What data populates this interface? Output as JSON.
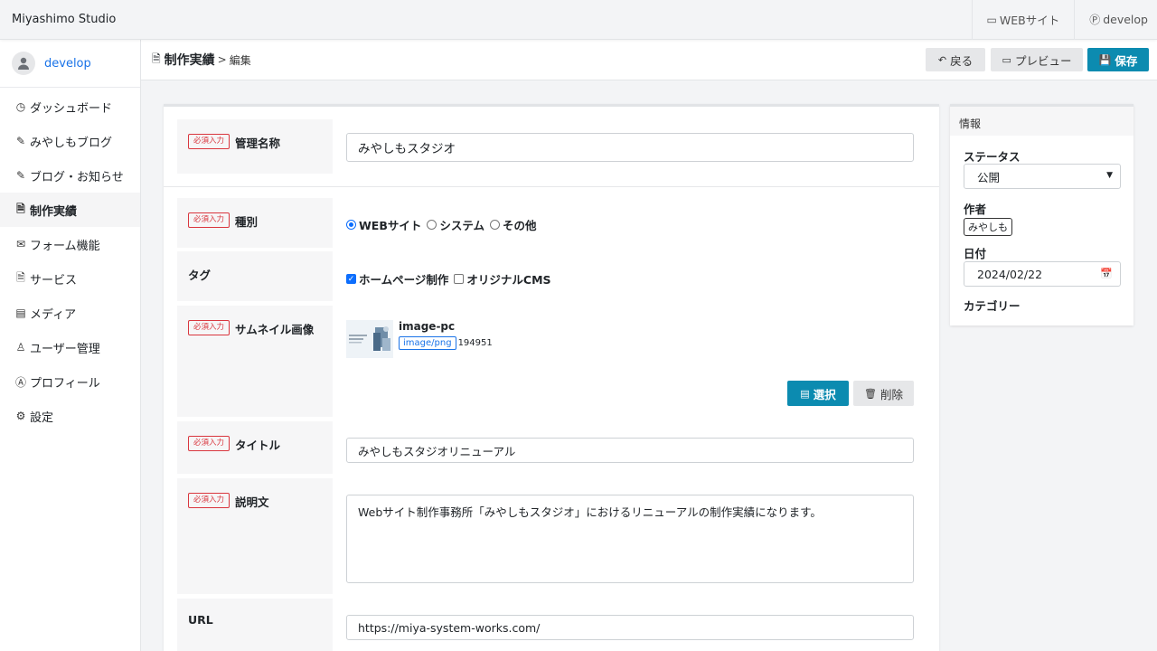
{
  "topbar": {
    "brand": "Miyashimo Studio",
    "website_link": "WEBサイト",
    "user_link": "develop"
  },
  "sidebar": {
    "user": "develop",
    "items": [
      {
        "label": "ダッシュボード",
        "icon": "dashboard-icon",
        "active": false
      },
      {
        "label": "みやしもブログ",
        "icon": "pencil-icon",
        "active": false
      },
      {
        "label": "ブログ・お知らせ",
        "icon": "pencil-icon",
        "active": false
      },
      {
        "label": "制作実績",
        "icon": "document-icon",
        "active": true
      },
      {
        "label": "フォーム機能",
        "icon": "mail-icon",
        "active": false
      },
      {
        "label": "サービス",
        "icon": "document-icon",
        "active": false
      },
      {
        "label": "メディア",
        "icon": "image-icon",
        "active": false
      },
      {
        "label": "ユーザー管理",
        "icon": "user-icon",
        "active": false
      },
      {
        "label": "プロフィール",
        "icon": "profile-icon",
        "active": false
      },
      {
        "label": "設定",
        "icon": "gear-icon",
        "active": false
      }
    ]
  },
  "header": {
    "title": "制作実績",
    "separator": ">",
    "sub": "編集",
    "back_label": "戻る",
    "preview_label": "プレビュー",
    "save_label": "保存"
  },
  "form": {
    "required_badge": "必須入力",
    "name_label": "管理名称",
    "name_value": "みやしもスタジオ",
    "type_label": "種別",
    "type_options": [
      "WEBサイト",
      "システム",
      "その他"
    ],
    "type_selected": "WEBサイト",
    "tag_label": "タグ",
    "tag_options": [
      "ホームページ制作",
      "オリジナルCMS"
    ],
    "tags_checked": [
      "ホームページ制作"
    ],
    "thumbnail_label": "サムネイル画像",
    "file_name": "image-pc",
    "file_mime": "image/png",
    "file_size": "194951",
    "select_label": "選択",
    "delete_label": "削除",
    "title_label": "タイトル",
    "title_value": "みやしもスタジオリニューアル",
    "description_label": "説明文",
    "description_value": "Webサイト制作事務所「みやしもスタジオ」におけるリニューアルの制作実績になります。",
    "url_label": "URL",
    "url_value": "https://miya-system-works.com/"
  },
  "info": {
    "heading": "情報",
    "status_label": "ステータス",
    "status_value": "公開",
    "author_label": "作者",
    "author_value": "みやしも",
    "date_label": "日付",
    "date_value": "2024/02/22",
    "category_label": "カテゴリー"
  },
  "colors": {
    "primary": "#0c8bb0",
    "link": "#1a73e8",
    "required": "#d9363e",
    "radio_checkbox": "#0d6efd"
  }
}
